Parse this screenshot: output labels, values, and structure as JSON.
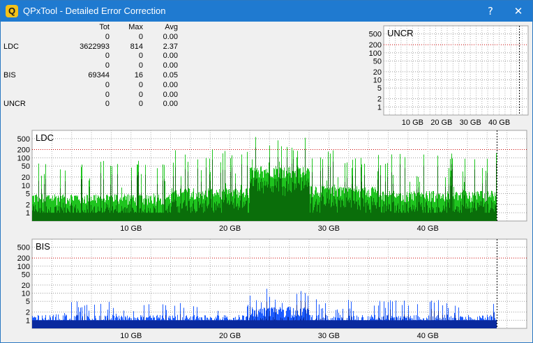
{
  "window": {
    "title": "QPxTool - Detailed Error Correction",
    "icon_letter": "Q",
    "help_label": "?",
    "close_label": "✕"
  },
  "stats": {
    "headers": [
      "Tot",
      "Max",
      "Avg"
    ],
    "rows": [
      {
        "label": "",
        "tot": "0",
        "max": "0",
        "avg": "0.00"
      },
      {
        "label": "LDC",
        "tot": "3622993",
        "max": "814",
        "avg": "2.37"
      },
      {
        "label": "",
        "tot": "0",
        "max": "0",
        "avg": "0.00"
      },
      {
        "label": "",
        "tot": "0",
        "max": "0",
        "avg": "0.00"
      },
      {
        "label": "BIS",
        "tot": "69344",
        "max": "16",
        "avg": "0.05"
      },
      {
        "label": "",
        "tot": "0",
        "max": "0",
        "avg": "0.00"
      },
      {
        "label": "",
        "tot": "0",
        "max": "0",
        "avg": "0.00"
      },
      {
        "label": "UNCR",
        "tot": "0",
        "max": "0",
        "avg": "0.00"
      }
    ]
  },
  "chart_data": [
    {
      "type": "bar",
      "title": "LDC",
      "y_scale": "log",
      "y_ticks": [
        500,
        200,
        100,
        50,
        20,
        10,
        5,
        2,
        1
      ],
      "x_ticks": [
        "10 GB",
        "20 GB",
        "30 GB",
        "40 GB"
      ],
      "x_tick_values": [
        10,
        20,
        30,
        40
      ],
      "x_range": [
        0,
        50
      ],
      "data_end": 47,
      "y_range": [
        0.5,
        1000
      ],
      "grid": true,
      "colors": {
        "bar": "#1fc41f",
        "dark": "#0a6e0a",
        "limit_line": "#cc0000"
      },
      "series": [
        {
          "values_by_gb": [
            {
              "x_range": [
                0,
                14
              ],
              "typical": 3,
              "peak": 80
            },
            {
              "x_range": [
                14,
                22
              ],
              "typical": 5,
              "peak": 200
            },
            {
              "x_range": [
                22,
                28
              ],
              "typical": 30,
              "peak": 700
            },
            {
              "x_range": [
                28,
                35
              ],
              "typical": 6,
              "peak": 200
            },
            {
              "x_range": [
                35,
                47
              ],
              "typical": 4,
              "peak": 150
            }
          ]
        }
      ]
    },
    {
      "type": "bar",
      "title": "BIS",
      "y_scale": "log",
      "y_ticks": [
        500,
        200,
        100,
        50,
        20,
        10,
        5,
        2,
        1
      ],
      "x_ticks": [
        "10 GB",
        "20 GB",
        "30 GB",
        "40 GB"
      ],
      "x_tick_values": [
        10,
        20,
        30,
        40
      ],
      "x_range": [
        0,
        50
      ],
      "data_end": 47,
      "y_range": [
        0.5,
        1000
      ],
      "grid": true,
      "colors": {
        "bar": "#1d5cff",
        "dark": "#0a2a9e",
        "limit_line": "#cc0000"
      },
      "series": [
        {
          "values_by_gb": [
            {
              "x_range": [
                0,
                22
              ],
              "typical": 1,
              "peak": 5
            },
            {
              "x_range": [
                22,
                28
              ],
              "typical": 2,
              "peak": 16
            },
            {
              "x_range": [
                28,
                47
              ],
              "typical": 1,
              "peak": 6
            }
          ]
        }
      ]
    },
    {
      "type": "bar",
      "title": "UNCR",
      "y_scale": "log",
      "y_ticks": [
        500,
        200,
        100,
        50,
        20,
        10,
        5,
        2,
        1
      ],
      "x_ticks": [
        "10 GB",
        "20 GB",
        "30 GB",
        "40 GB"
      ],
      "x_tick_values": [
        10,
        20,
        30,
        40
      ],
      "x_range": [
        0,
        50
      ],
      "data_end": 47,
      "y_range": [
        0.5,
        1000
      ],
      "grid": true,
      "colors": {
        "bar": "#1fc41f",
        "dark": "#0a6e0a",
        "limit_line": "#cc0000"
      },
      "series": [
        {
          "values_by_gb": []
        }
      ]
    }
  ]
}
